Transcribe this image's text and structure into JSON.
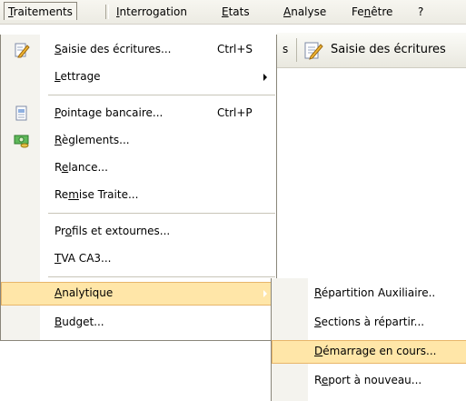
{
  "menubar": {
    "items": [
      {
        "pre": "",
        "u": "T",
        "post": "raitements"
      },
      {
        "pre": "",
        "u": "I",
        "post": "nterrogation"
      },
      {
        "pre": "",
        "u": "E",
        "post": "tats"
      },
      {
        "pre": "",
        "u": "A",
        "post": "nalyse"
      },
      {
        "pre": "Fe",
        "u": "n",
        "post": "être"
      },
      {
        "pre": "",
        "u": "?",
        "post": ""
      }
    ]
  },
  "toolbar": {
    "fragment": "s",
    "button_label": "Saisie des écritures"
  },
  "dropdown": {
    "items": [
      {
        "pre": "",
        "u": "S",
        "post": "aisie des écritures...",
        "shortcut": "Ctrl+S",
        "icon": "pencil-doc-icon"
      },
      {
        "pre": "",
        "u": "L",
        "post": "ettrage",
        "shortcut": "",
        "icon": ""
      },
      {
        "pre": "",
        "u": "P",
        "post": "ointage bancaire...",
        "shortcut": "Ctrl+P",
        "icon": "bank-doc-icon"
      },
      {
        "pre": "",
        "u": "R",
        "post": "èglements...",
        "shortcut": "",
        "icon": "money-icon"
      },
      {
        "pre": "R",
        "u": "e",
        "post": "lance...",
        "shortcut": "",
        "icon": ""
      },
      {
        "pre": "Re",
        "u": "m",
        "post": "ise Traite...",
        "shortcut": "",
        "icon": ""
      },
      {
        "pre": "Pr",
        "u": "o",
        "post": "fils et extournes...",
        "shortcut": "",
        "icon": ""
      },
      {
        "pre": "",
        "u": "T",
        "post": "VA CA3...",
        "shortcut": "",
        "icon": ""
      },
      {
        "pre": "",
        "u": "A",
        "post": "nalytique",
        "shortcut": "",
        "icon": ""
      },
      {
        "pre": "",
        "u": "B",
        "post": "udget...",
        "shortcut": "",
        "icon": ""
      }
    ]
  },
  "submenu": {
    "items": [
      {
        "pre": "",
        "u": "R",
        "post": "épartition Auxiliaire.."
      },
      {
        "pre": "",
        "u": "S",
        "post": "ections à répartir..."
      },
      {
        "pre": "",
        "u": "D",
        "post": "émarrage en cours..."
      },
      {
        "pre": "R",
        "u": "e",
        "post": "port à nouveau..."
      }
    ]
  },
  "colors": {
    "highlight": "#ffe6a8",
    "highlight_border": "#e8b66a",
    "gutter": "#f4f3ee"
  }
}
